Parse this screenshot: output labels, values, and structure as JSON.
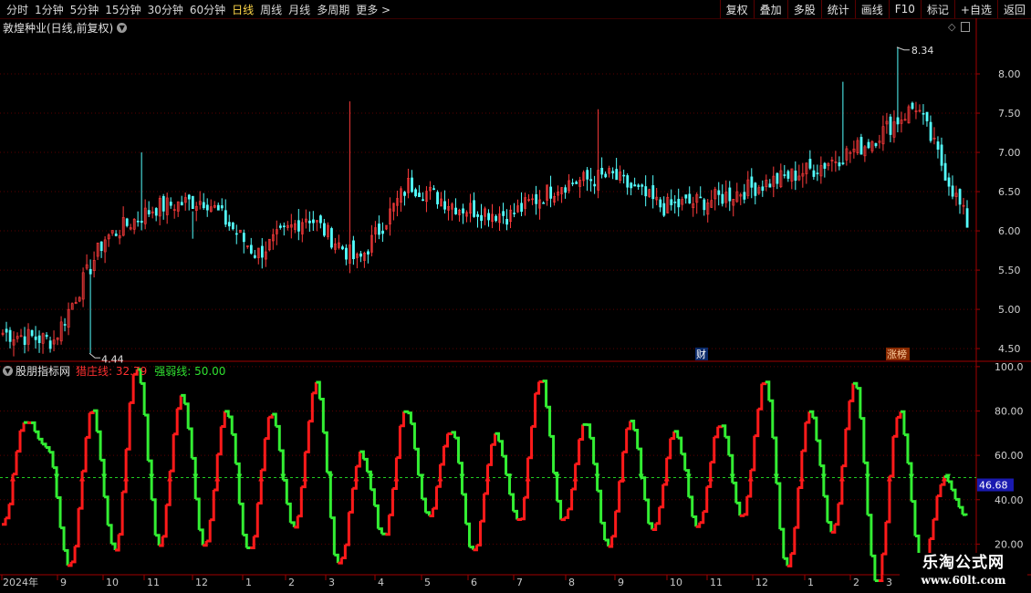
{
  "toolbar": {
    "periods": [
      "分时",
      "1分钟",
      "5分钟",
      "15分钟",
      "30分钟",
      "60分钟",
      "日线",
      "周线",
      "月线",
      "多周期",
      "更多 >"
    ],
    "active_period": "日线",
    "buttons": [
      "复权",
      "叠加",
      "多股",
      "统计",
      "画线",
      "F10",
      "标记",
      "+自选",
      "返回"
    ]
  },
  "main_panel": {
    "title": "敦煌种业(日线,前复权)",
    "y_ticks": [
      "8.00",
      "7.50",
      "7.00",
      "6.50",
      "6.00",
      "5.50",
      "5.00",
      "4.50"
    ],
    "high_label": "8.34",
    "low_label": "4.44",
    "badges": [
      "财",
      "涨榜"
    ]
  },
  "indicator_panel": {
    "name": "股朋指标网",
    "line1": "猎庄线: 32.79",
    "line2": "强弱线: 50.00",
    "y_ticks": [
      "100.0",
      "80.00",
      "60.00",
      "40.00",
      "20.00"
    ],
    "current_value": "46.68"
  },
  "x_axis": {
    "labels": [
      "2024年",
      "9",
      "10",
      "11",
      "12",
      "1",
      "2",
      "3",
      "4",
      "5",
      "6",
      "7",
      "8",
      "9",
      "10",
      "11",
      "12",
      "1",
      "2",
      "3"
    ]
  },
  "watermark": {
    "line1": "乐淘公式网",
    "line2": "www.60lt.com"
  },
  "colors": {
    "up": "#ff3c3c",
    "down": "#54ffff",
    "ind_up": "#ff1a1a",
    "ind_down": "#33ee33",
    "grid": "#5a0000",
    "active_period": "#ffd84a"
  },
  "chart_data": [
    {
      "type": "candlestick",
      "title": "敦煌种业(日线,前复权)",
      "y_range": [
        4.35,
        8.5
      ],
      "y_ticks": [
        8.0,
        7.5,
        7.0,
        6.5,
        6.0,
        5.5,
        5.0,
        4.5
      ],
      "high": 8.34,
      "low": 4.44,
      "close_path": [
        {
          "month": "2024-08",
          "close": 4.7
        },
        {
          "month": "2024-09",
          "close": 4.6
        },
        {
          "month": "2024-10",
          "close": 5.9
        },
        {
          "month": "2024-11",
          "close": 6.3
        },
        {
          "month": "2024-12",
          "close": 6.4
        },
        {
          "month": "2025-01",
          "close": 5.7
        },
        {
          "month": "2025-02",
          "close": 6.2
        },
        {
          "month": "2025-03",
          "close": 5.6
        },
        {
          "month": "2025-04",
          "close": 6.6
        },
        {
          "month": "2025-05",
          "close": 6.3
        },
        {
          "month": "2025-06",
          "close": 6.2
        },
        {
          "month": "2025-07",
          "close": 6.6
        },
        {
          "month": "2025-08",
          "close": 6.7
        },
        {
          "month": "2025-09",
          "close": 6.3
        },
        {
          "month": "2025-10",
          "close": 6.4
        },
        {
          "month": "2025-11",
          "close": 6.6
        },
        {
          "month": "2025-12",
          "close": 6.8
        },
        {
          "month": "2026-01",
          "close": 7.1
        },
        {
          "month": "2026-02",
          "close": 7.6
        },
        {
          "month": "2026-03",
          "close": 6.1
        }
      ]
    },
    {
      "type": "line",
      "title": "股朋指标网",
      "series": [
        {
          "name": "猎庄线",
          "last": 32.79
        },
        {
          "name": "强弱线",
          "value": 50.0
        }
      ],
      "y_range": [
        7,
        102
      ],
      "y_ticks": [
        100,
        80,
        60,
        40,
        20
      ],
      "current": 46.68,
      "peaks_troughs": [
        28,
        76,
        63,
        9,
        80,
        17,
        100,
        20,
        88,
        20,
        80,
        16,
        80,
        26,
        92,
        10,
        61,
        24,
        80,
        33,
        72,
        16,
        70,
        30,
        94,
        30,
        75,
        19,
        75,
        27,
        70,
        28,
        74,
        33,
        93,
        10,
        80,
        25,
        93,
        3,
        79,
        10,
        50,
        33
      ]
    }
  ]
}
